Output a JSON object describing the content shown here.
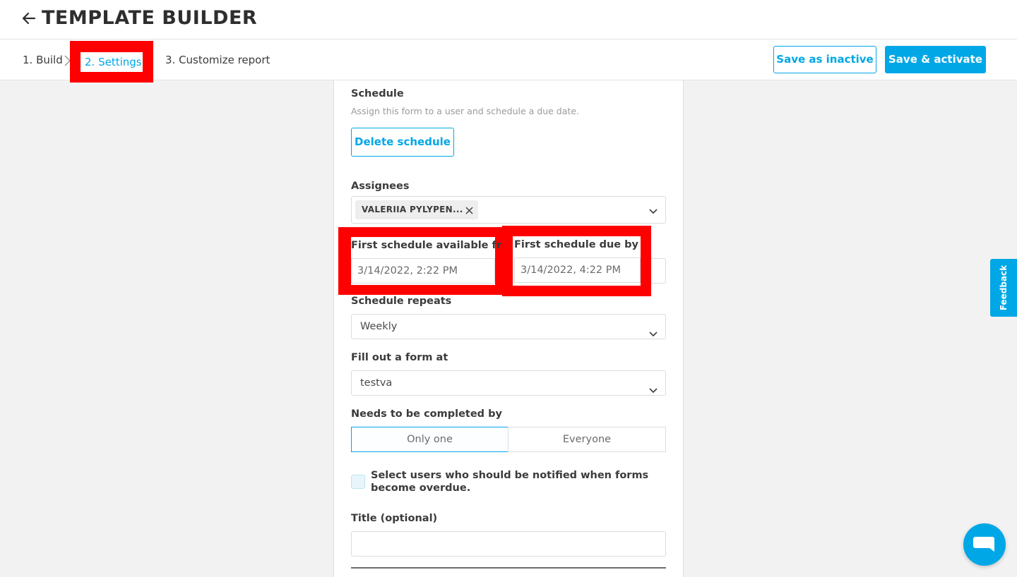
{
  "header": {
    "title": "TEMPLATE BUILDER"
  },
  "steps": [
    {
      "label": "1. Build"
    },
    {
      "label": "2. Settings"
    },
    {
      "label": "3. Customize report"
    }
  ],
  "actions": {
    "save_inactive": "Save as inactive",
    "save_activate": "Save & activate"
  },
  "schedule": {
    "title": "Schedule",
    "description": "Assign this form to a user and schedule a due date.",
    "delete_label": "Delete schedule",
    "assignees_label": "Assignees",
    "assignee_chip": "VALERIIA PYLYPEN...",
    "available_from_label": "First schedule available from",
    "available_from_value": "3/14/2022, 2:22 PM",
    "due_by_label": "First schedule due by",
    "due_by_value": "3/14/2022, 4:22 PM",
    "repeats_label": "Schedule repeats",
    "repeats_value": "Weekly",
    "fill_at_label": "Fill out a form at",
    "fill_at_value": "testva",
    "completed_by_label": "Needs to be completed by",
    "completed_by_options": [
      "Only one",
      "Everyone"
    ],
    "completed_by_selected": "Only one",
    "notify_label": "Select users who should be notified when forms become overdue.",
    "title_label": "Title (optional)",
    "title_value": ""
  },
  "feedback": {
    "label": "Feedback"
  },
  "colors": {
    "accent": "#00a7e6",
    "highlight": "#ff0000"
  }
}
